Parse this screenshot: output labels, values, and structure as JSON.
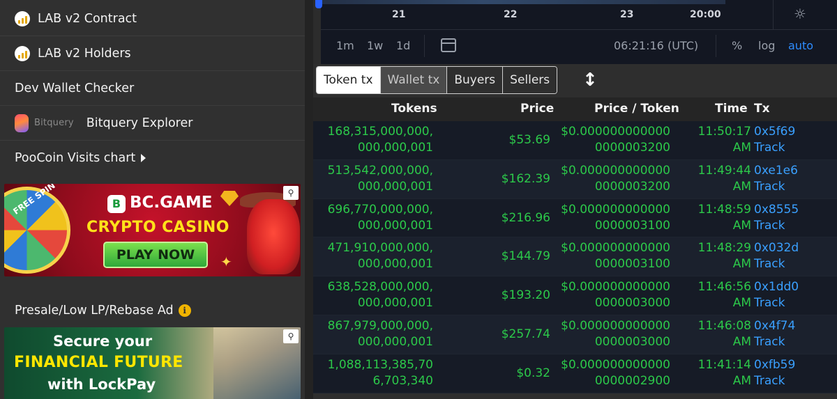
{
  "sidebar": {
    "items": [
      {
        "label": "LAB v2 Contract",
        "icon": "chart-bars-icon"
      },
      {
        "label": "LAB v2 Holders",
        "icon": "chart-bars-icon"
      },
      {
        "label": "Dev Wallet Checker"
      },
      {
        "label": "Bitquery Explorer",
        "brand": "Bitquery",
        "icon": "bitquery-logo-icon"
      },
      {
        "label": "PooCoin Visits chart",
        "icon": "caret-right-icon"
      }
    ],
    "ad1": {
      "free_spin": "FREE SPIN",
      "brand": "BC.GAME",
      "logo_letter": "B",
      "headline": "CRYPTO CASINO",
      "cta": "PLAY NOW"
    },
    "presale_label": "Presale/Low LP/Rebase Ad",
    "ad2": {
      "line1": "Secure your",
      "line2": "FINANCIAL FUTURE",
      "line3": "with LockPay"
    }
  },
  "chart": {
    "ticks": [
      "21",
      "22",
      "23",
      "20:00"
    ],
    "timeframes": [
      "1m",
      "1w",
      "1d"
    ],
    "clock": "06:21:16 (UTC)",
    "options": [
      "%",
      "log",
      "auto"
    ],
    "active_option": "auto"
  },
  "tx": {
    "tabs": [
      "Token tx",
      "Wallet tx",
      "Buyers",
      "Sellers"
    ],
    "columns": [
      "Tokens",
      "Price",
      "Price / Token",
      "Time",
      "Tx"
    ],
    "rows": [
      {
        "tokens": "168,315,000,000,000,000,001",
        "price": "$53.69",
        "ppt": "$0.0000000000000000003200",
        "time1": "11:50:17",
        "time2": "AM",
        "hash": "0x5f69",
        "track": "Track"
      },
      {
        "tokens": "513,542,000,000,000,000,001",
        "price": "$162.39",
        "ppt": "$0.0000000000000000003200",
        "time1": "11:49:44",
        "time2": "AM",
        "hash": "0xe1e6",
        "track": "Track"
      },
      {
        "tokens": "696,770,000,000,000,000,001",
        "price": "$216.96",
        "ppt": "$0.0000000000000000003100",
        "time1": "11:48:59",
        "time2": "AM",
        "hash": "0x8555",
        "track": "Track"
      },
      {
        "tokens": "471,910,000,000,000,000,001",
        "price": "$144.79",
        "ppt": "$0.0000000000000000003100",
        "time1": "11:48:29",
        "time2": "AM",
        "hash": "0x032d",
        "track": "Track"
      },
      {
        "tokens": "638,528,000,000,000,000,001",
        "price": "$193.20",
        "ppt": "$0.0000000000000000003000",
        "time1": "11:46:56",
        "time2": "AM",
        "hash": "0x1dd0",
        "track": "Track"
      },
      {
        "tokens": "867,979,000,000,000,000,001",
        "price": "$257.74",
        "ppt": "$0.0000000000000000003000",
        "time1": "11:46:08",
        "time2": "AM",
        "hash": "0x4f74",
        "track": "Track"
      },
      {
        "tokens": "1,088,113,385,706,703,340",
        "price": "$0.32",
        "ppt": "$0.0000000000000000002900",
        "time1": "11:41:14",
        "time2": "AM",
        "hash": "0xfb59",
        "track": "Track"
      }
    ]
  },
  "colors": {
    "sidebar_bg": "#303030",
    "chart_bg": "#131722",
    "buy_green": "#2cc94a",
    "link_blue": "#3aa0ff",
    "accent_blue": "#2e8cff"
  }
}
